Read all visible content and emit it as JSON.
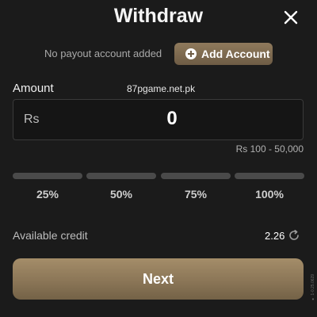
{
  "header": {
    "title": "Withdraw"
  },
  "payout": {
    "message": "No payout account added",
    "add_account_label": "Add Account"
  },
  "amount": {
    "label": "Amount",
    "currency": "Rs",
    "value": "0",
    "range": "Rs 100 - 50,000"
  },
  "watermark": "87pgame.net.pk",
  "presets": [
    {
      "label": "25%"
    },
    {
      "label": "50%"
    },
    {
      "label": "75%"
    },
    {
      "label": "100%"
    }
  ],
  "credit": {
    "label": "Available credit",
    "value": "2.26"
  },
  "next_label": "Next",
  "side_text": "● 1-0.25.0629",
  "colors": {
    "background": "#1b1b1b",
    "accent_gold": "#8b7657",
    "bar_gray": "#4a4a4a"
  },
  "icons": [
    "close-icon",
    "plus-circle-icon",
    "refresh-icon"
  ]
}
